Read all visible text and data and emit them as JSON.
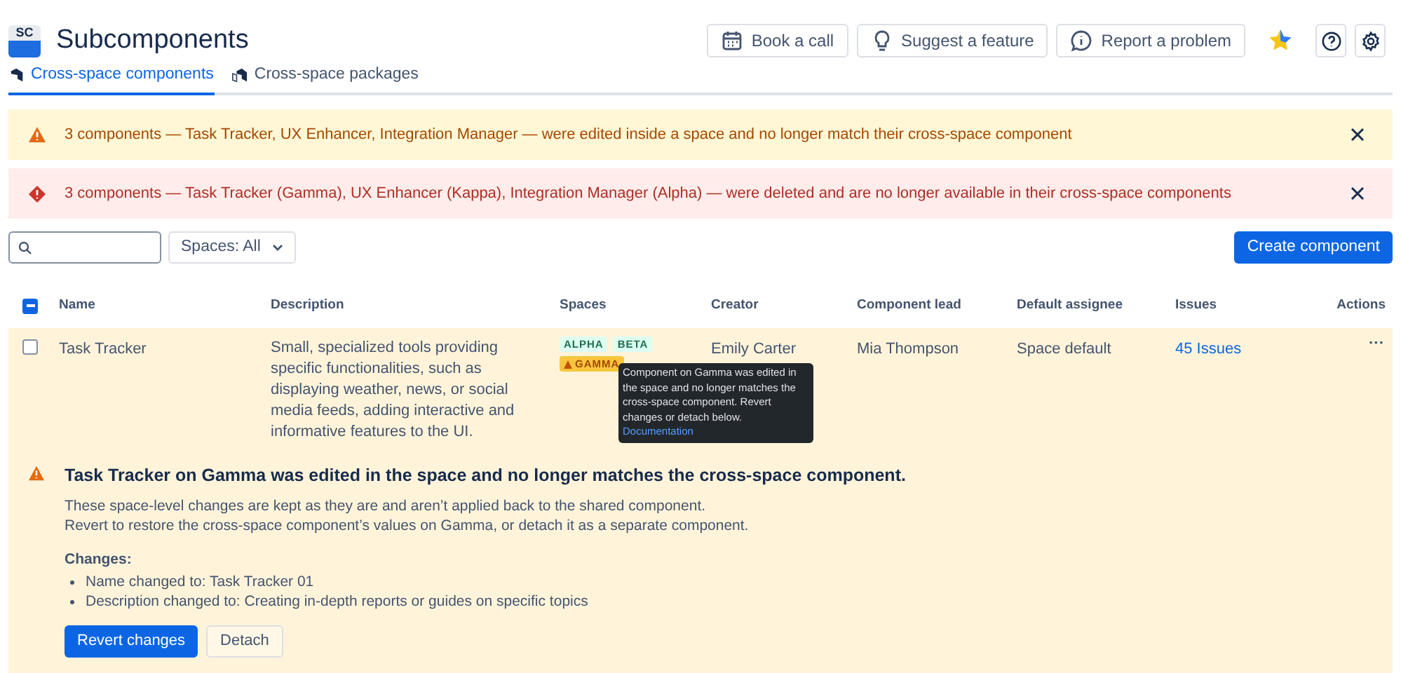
{
  "app": {
    "logo": "SC",
    "title": "Subcomponents"
  },
  "header_buttons": [
    "Book a call",
    "Suggest a feature",
    "Report a problem"
  ],
  "tabs": [
    {
      "label": "Cross-space components",
      "selected": true
    },
    {
      "label": "Cross-space packages",
      "selected": false
    }
  ],
  "banners": [
    {
      "kind": "warning",
      "text": "3 components — Task Tracker, UX Enhancer, Integration Manager — were edited inside a space and no longer match their cross-space component"
    },
    {
      "kind": "error",
      "text": "3 components — Task Tracker (Gamma), UX Enhancer (Kappa), Integration Manager (Alpha) — were deleted and are no longer available in their cross-space components"
    }
  ],
  "filter": {
    "label": "Spaces: All"
  },
  "create_button": "Create component",
  "table": {
    "select_all": {
      "checked": true
    },
    "columns": [
      "Name",
      "Description",
      "Spaces",
      "Creator",
      "Component lead",
      "Default assignee",
      "Issues",
      "Actions"
    ],
    "rows": [
      {
        "checked": false,
        "name": "Task Tracker",
        "description": "Small, specialized tools providing specific functionalities, such as displaying weather, news, or social media feeds, adding interactive and informative features to the UI.",
        "spaces": [
          {
            "label": "ALPHA",
            "kind": "ok"
          },
          {
            "label": "BETA",
            "kind": "ok"
          },
          {
            "label": "GAMMA",
            "kind": "warning"
          }
        ],
        "tooltip": {
          "text": "Component on Gamma was edited in the space and no longer matches the cross-space component. Revert changes or detach below.",
          "link": "Documentation"
        },
        "creator": "Emily Carter",
        "lead": "Mia Thompson",
        "assignee": "Space default",
        "issues": "45 Issues",
        "actions": "···",
        "detail": {
          "title": "Task Tracker on Gamma was edited in the space and no longer matches the cross-space component.",
          "lines": [
            "These space-level changes are kept as they are and aren’t applied back to the shared component.",
            "Revert to restore the cross-space component’s values on Gamma, or detach it as a separate component."
          ],
          "changes_heading": "Changes:",
          "changes": [
            "Name changed to: Task Tracker 01",
            "Description changed to: Creating in-depth reports or guides on specific topics"
          ],
          "buttons": [
            {
              "label": "Revert changes",
              "kind": "primary"
            },
            {
              "label": "Detach",
              "kind": "secondary"
            }
          ]
        }
      }
    ]
  }
}
